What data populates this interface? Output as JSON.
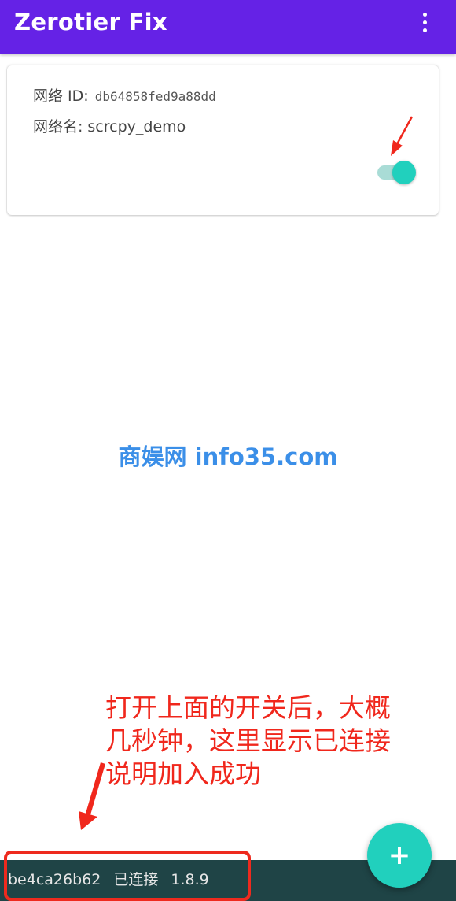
{
  "appbar": {
    "title": "Zerotier Fix",
    "menu_icon": "more-vert-icon"
  },
  "network_card": {
    "id_label": "网络 ID:",
    "id_value": "db64858fed9a88dd",
    "name_label": "网络名:",
    "name_value": "scrcpy_demo",
    "switch_on": true
  },
  "watermark": {
    "text": "商娱网 info35.com"
  },
  "annotation": {
    "line1": "打开上面的开关后，大概",
    "line2": "几秒钟，这里显示已连接",
    "line3": "说明加入成功"
  },
  "status_bar": {
    "node_id": "be4ca26b62",
    "state": "已连接",
    "version": "1.8.9"
  },
  "fab": {
    "icon": "add-icon",
    "glyph": "+"
  },
  "colors": {
    "appbar": "#6522e6",
    "accent": "#21d0bd",
    "status_bar": "#1f4446",
    "annotation_red": "#f0271c",
    "watermark_blue": "#3b8fe8"
  }
}
